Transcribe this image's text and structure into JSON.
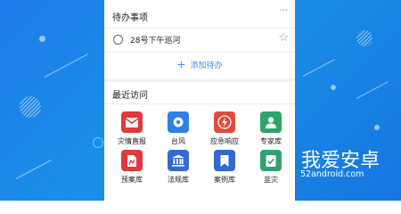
{
  "todo": {
    "title": "待办事项",
    "more_label": "···",
    "items": [
      {
        "text": "28号下午巡河"
      }
    ],
    "add_plus": "+",
    "add_label": "添加待办"
  },
  "recent": {
    "title": "最近访问",
    "tiles": [
      {
        "label": "灾情直报",
        "icon": "envelope-icon",
        "color": "#e0393e"
      },
      {
        "label": "台风",
        "icon": "typhoon-icon",
        "color": "#2e7fe6"
      },
      {
        "label": "应急响应",
        "icon": "lightning-icon",
        "color": "#e24a3b"
      },
      {
        "label": "专家库",
        "icon": "person-icon",
        "color": "#2fa36b"
      },
      {
        "label": "预案库",
        "icon": "plan-doc-icon",
        "color": "#e0393e"
      },
      {
        "label": "法规库",
        "icon": "courthouse-icon",
        "color": "#3469d1"
      },
      {
        "label": "案例库",
        "icon": "bookmark-icon",
        "color": "#3469d1"
      },
      {
        "label": "韭灾",
        "icon": "check-icon",
        "color": "#2fa36b"
      }
    ]
  },
  "watermark": {
    "name": "我爱安卓",
    "url": "52android.com"
  },
  "colors": {
    "accent": "#3d8cf0",
    "background": "#1a85e8"
  }
}
